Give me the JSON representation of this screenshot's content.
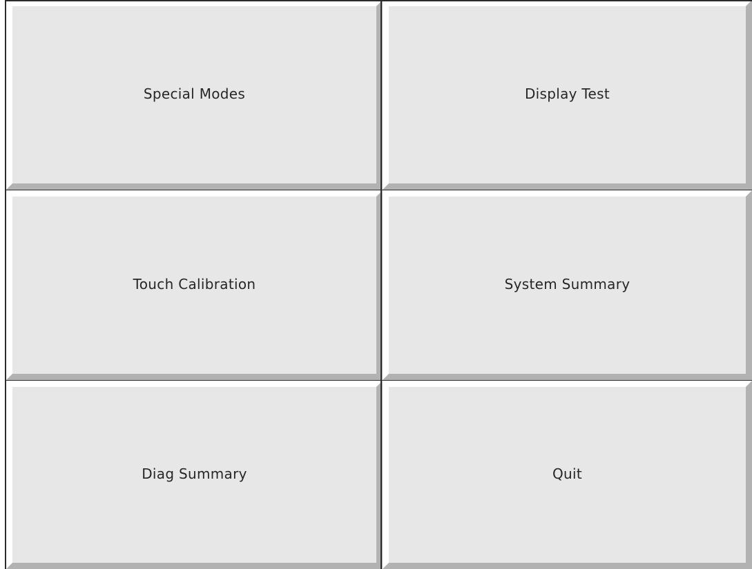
{
  "menu": {
    "buttons": [
      {
        "id": "special-modes",
        "label": "Special Modes"
      },
      {
        "id": "display-test",
        "label": "Display Test"
      },
      {
        "id": "touch-calibration",
        "label": "Touch Calibration"
      },
      {
        "id": "system-summary",
        "label": "System Summary"
      },
      {
        "id": "diag-summary",
        "label": "Diag Summary"
      },
      {
        "id": "quit",
        "label": "Quit"
      }
    ]
  },
  "colors": {
    "button_face": "#e6e7e6",
    "highlight": "#ffffff",
    "shadow": "#b1b2b1",
    "divider": "#2b2b2b",
    "text": "#262626"
  }
}
